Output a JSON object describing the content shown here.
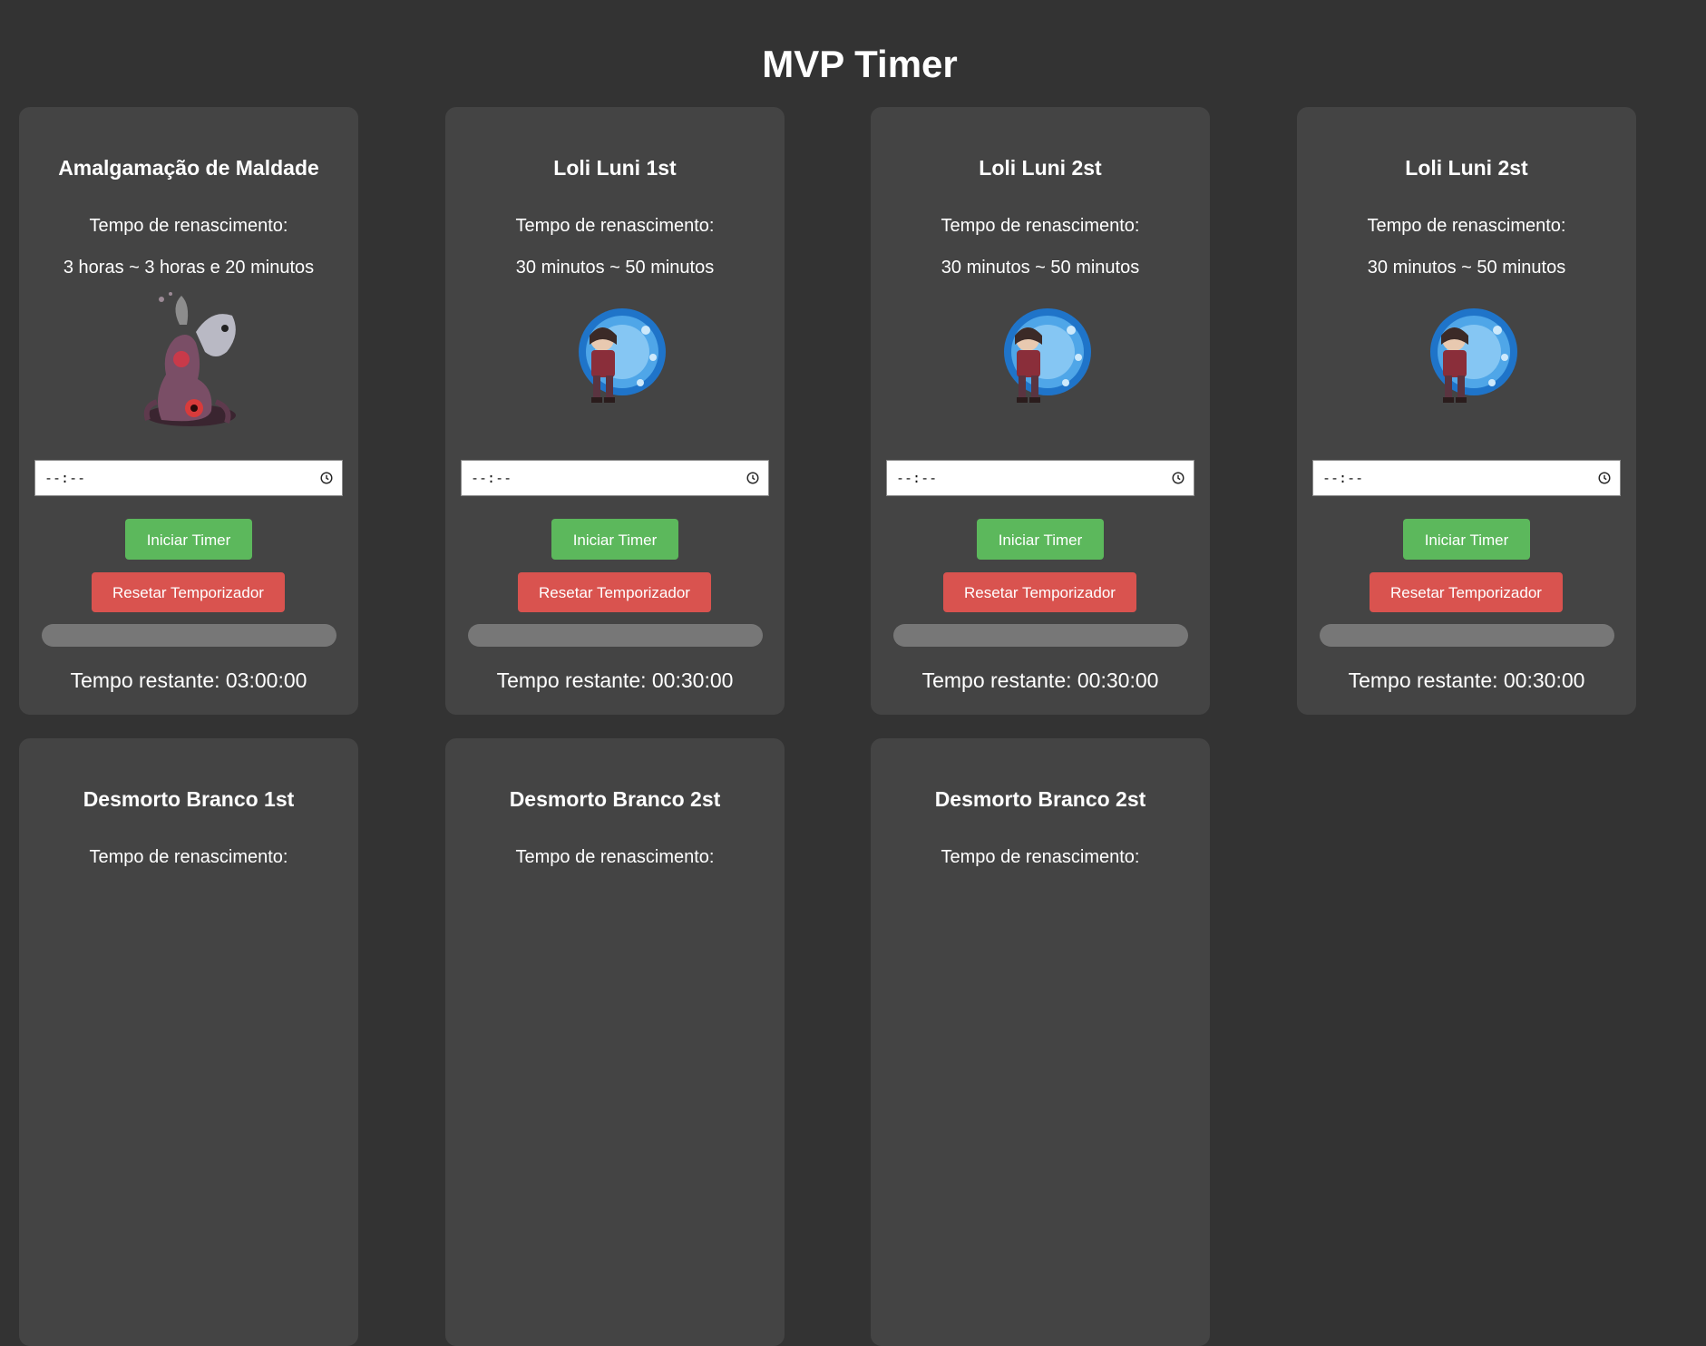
{
  "page": {
    "title": "MVP Timer"
  },
  "cards": [
    {
      "name": "Amalgamação de Maldade",
      "respawn_label": "Tempo de renascimento:",
      "respawn_value": "3 horas ~ 3 horas e 20 minutos",
      "sprite": "amalgamation-sprite",
      "time_input": "--:--",
      "start_label": "Iniciar Timer",
      "reset_label": "Resetar Temporizador",
      "progress_fraction": 0,
      "remaining": "Tempo restante: 03:00:00"
    },
    {
      "name": "Loli Luni 1st",
      "respawn_label": "Tempo de renascimento:",
      "respawn_value": "30 minutos ~ 50 minutos",
      "sprite": "loli-luni-sprite",
      "time_input": "--:--",
      "start_label": "Iniciar Timer",
      "reset_label": "Resetar Temporizador",
      "progress_fraction": 0,
      "remaining": "Tempo restante: 00:30:00"
    },
    {
      "name": "Loli Luni 2st",
      "respawn_label": "Tempo de renascimento:",
      "respawn_value": "30 minutos ~ 50 minutos",
      "sprite": "loli-luni-sprite",
      "time_input": "--:--",
      "start_label": "Iniciar Timer",
      "reset_label": "Resetar Temporizador",
      "progress_fraction": 0,
      "remaining": "Tempo restante: 00:30:00"
    },
    {
      "name": "Loli Luni 2st",
      "respawn_label": "Tempo de renascimento:",
      "respawn_value": "30 minutos ~ 50 minutos",
      "sprite": "loli-luni-sprite",
      "time_input": "--:--",
      "start_label": "Iniciar Timer",
      "reset_label": "Resetar Temporizador",
      "progress_fraction": 0,
      "remaining": "Tempo restante: 00:30:00"
    },
    {
      "name": "Desmorto Branco 1st",
      "respawn_label": "Tempo de renascimento:"
    },
    {
      "name": "Desmorto Branco 2st",
      "respawn_label": "Tempo de renascimento:"
    },
    {
      "name": "Desmorto Branco 2st",
      "respawn_label": "Tempo de renascimento:"
    }
  ],
  "colors": {
    "background": "#333333",
    "card": "#444444",
    "start_button": "#5cb85c",
    "reset_button": "#d9534f",
    "progress_track": "#777777"
  }
}
